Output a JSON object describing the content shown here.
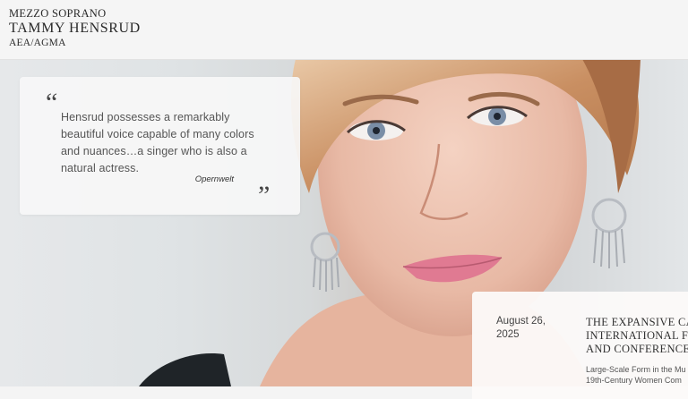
{
  "header": {
    "subtitle": "MEZZO SOPRANO",
    "name": "TAMMY HENSRUD",
    "union": "AEA/AGMA"
  },
  "quote": {
    "open_mark": "“",
    "text": "Hensrud possesses a remarkably beautiful voice capable of many colors and nuances…a singer who is also a natural actress.",
    "source": "Opernwelt",
    "close_mark": "”"
  },
  "event": {
    "date_line1": "August 26,",
    "date_line2": "2025",
    "title_line1": "THE EXPANSIVE CA",
    "title_line2": "INTERNATIONAL FE",
    "title_line3": "AND CONFERENCE",
    "desc_line1": "Large-Scale Form in the Mu",
    "desc_line2": "19th-Century Women Com"
  },
  "colors": {
    "header_bg": "#f5f5f5",
    "card_bg": "#f7f7f7",
    "text_dark": "#2a2a2a",
    "lip_pink": "#e07a92"
  },
  "hero_image": "portrait-photo"
}
